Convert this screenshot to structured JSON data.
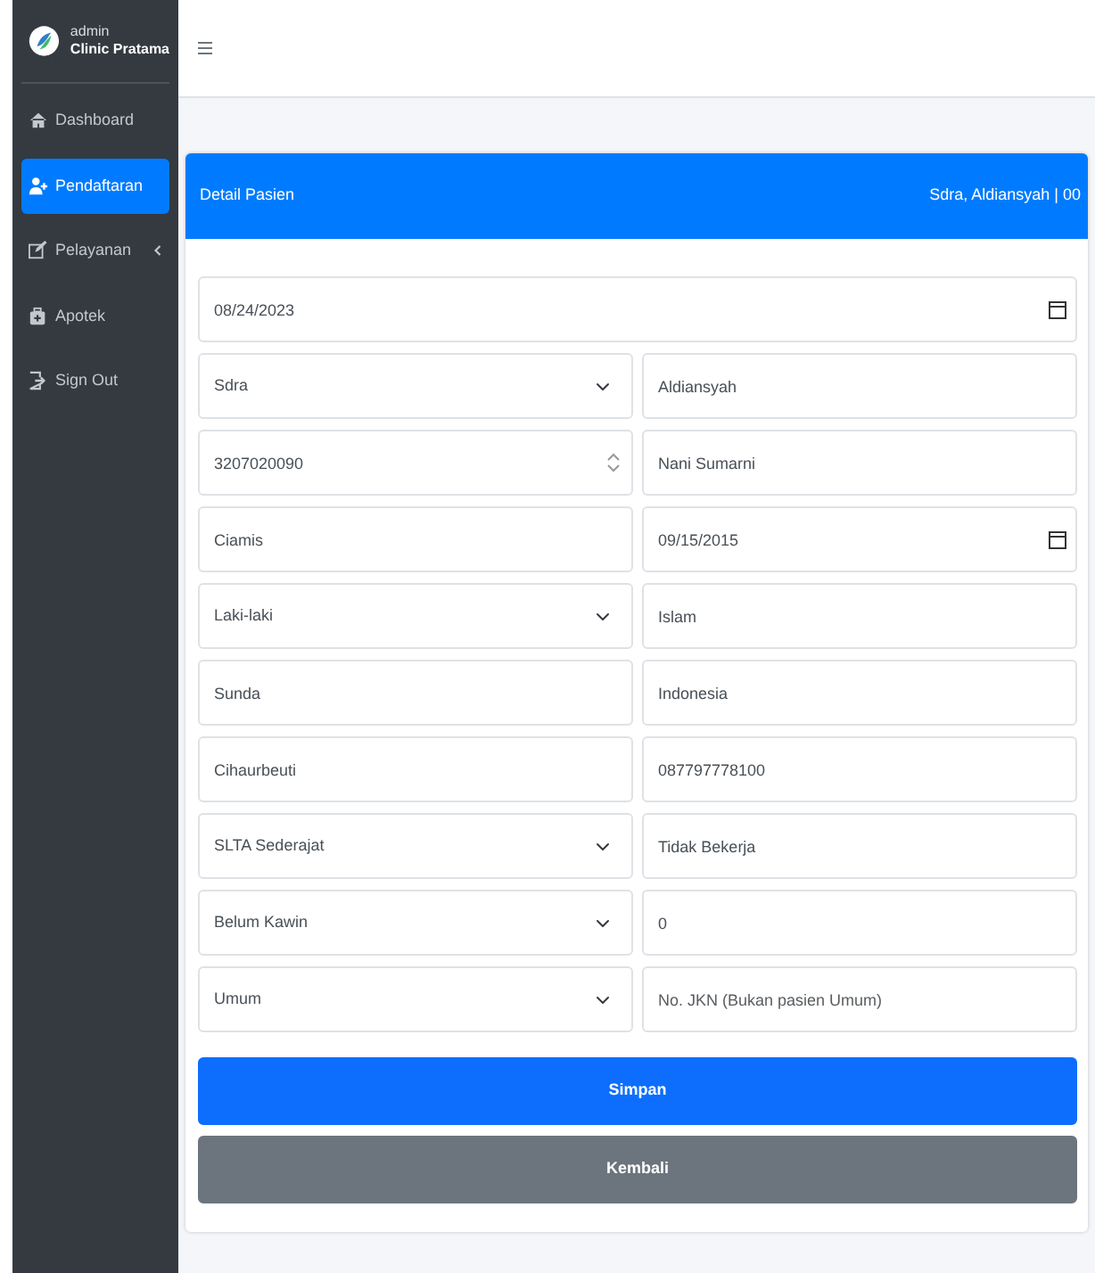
{
  "sidebar": {
    "user": "admin",
    "brand": "Clinic Pratama",
    "items": [
      {
        "label": "Dashboard",
        "selected": false
      },
      {
        "label": "Pendaftaran",
        "selected": true
      },
      {
        "label": "Pelayanan",
        "selected": false,
        "expanded": false
      },
      {
        "label": "Apotek",
        "selected": false
      },
      {
        "label": "Sign Out",
        "selected": false
      }
    ]
  },
  "card": {
    "title": "Detail Pasien",
    "subtitle": "Sdra, Aldiansyah | 00"
  },
  "form": {
    "rows": [
      [
        {
          "kind": "date",
          "value": "08/24/2023"
        }
      ],
      [
        {
          "kind": "select",
          "value": "Sdra"
        },
        {
          "kind": "text",
          "value": "Aldiansyah"
        }
      ],
      [
        {
          "kind": "number",
          "value": "3207020090"
        },
        {
          "kind": "text",
          "value": "Nani Sumarni"
        }
      ],
      [
        {
          "kind": "text",
          "value": "Ciamis"
        },
        {
          "kind": "date",
          "value": "09/15/2015"
        }
      ],
      [
        {
          "kind": "select",
          "value": "Laki-laki"
        },
        {
          "kind": "text",
          "value": "Islam"
        }
      ],
      [
        {
          "kind": "text",
          "value": "Sunda"
        },
        {
          "kind": "text",
          "value": "Indonesia"
        }
      ],
      [
        {
          "kind": "text",
          "value": "Cihaurbeuti"
        },
        {
          "kind": "text",
          "value": "087797778100"
        }
      ],
      [
        {
          "kind": "select",
          "value": "SLTA Sederajat"
        },
        {
          "kind": "text",
          "value": "Tidak Bekerja"
        }
      ],
      [
        {
          "kind": "select",
          "value": "Belum Kawin"
        },
        {
          "kind": "text",
          "value": "0"
        }
      ],
      [
        {
          "kind": "select",
          "value": "Umum"
        },
        {
          "kind": "text",
          "placeholder": "No. JKN (Bukan pasien Umum)"
        }
      ]
    ]
  },
  "buttons": [
    {
      "label": "Simpan",
      "kind": "primary"
    },
    {
      "label": "Kembali",
      "kind": "secondary"
    }
  ]
}
